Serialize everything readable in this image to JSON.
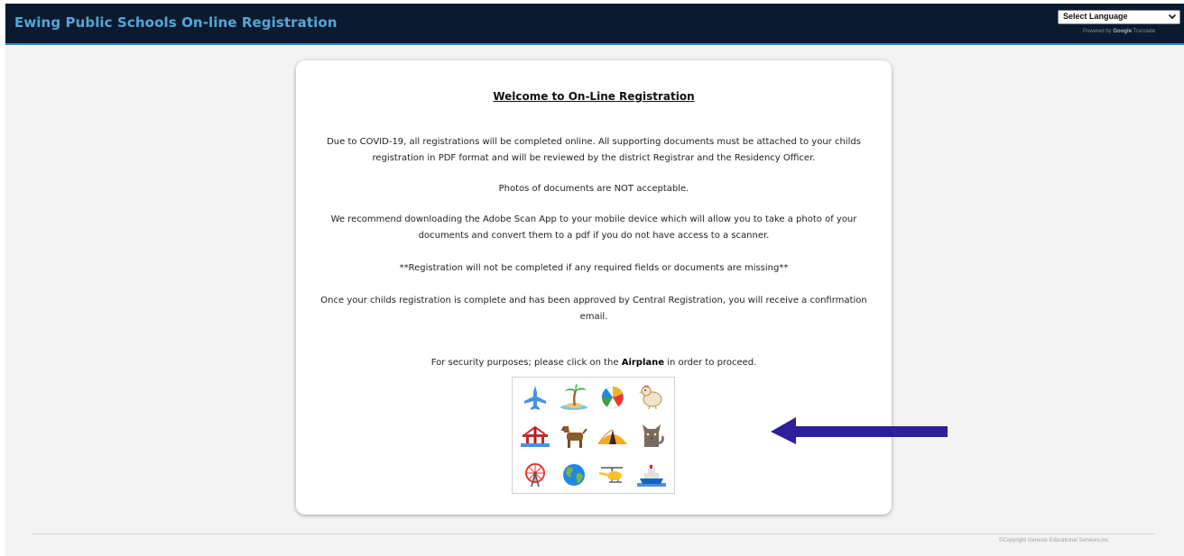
{
  "header": {
    "title": "Ewing Public Schools On-line Registration",
    "language_select": {
      "selected": "Select Language",
      "powered_prefix": "Powered by ",
      "powered_brand": "Google",
      "powered_suffix": " Translate"
    }
  },
  "card": {
    "title": "Welcome to On-Line Registration",
    "paragraphs": [
      "Due to COVID-19, all registrations will be completed online. All supporting documents must be attached to your childs registration in PDF format and will be reviewed by the district Registrar and the Residency Officer.",
      "Photos of documents are NOT acceptable.",
      "We recommend downloading the Adobe Scan App to your mobile device which will allow you to take a photo of your documents and convert them to a pdf if you do not have access to a scanner.",
      "**Registration will not be completed if any required fields or documents are missing**",
      "Once your childs registration is complete and has been approved by Central Registration, you will receive a confirmation email."
    ],
    "security": {
      "prefix": "For security purposes; please click on the ",
      "target": "Airplane",
      "suffix": " in order to proceed."
    },
    "captcha_icons": [
      "airplane-icon",
      "palm-tree-island-icon",
      "beach-ball-icon",
      "chicken-icon",
      "bridge-icon",
      "dog-icon",
      "tent-icon",
      "cat-icon",
      "ferris-wheel-icon",
      "globe-icon",
      "helicopter-icon",
      "ship-icon"
    ]
  },
  "footer": {
    "copyright": "©Copyright Genesis Educational Services,Inc."
  },
  "colors": {
    "header_bg": "#0b1a30",
    "header_title": "#52a8d8",
    "page_bg": "#f3f3f3",
    "arrow": "#2e1f9c"
  }
}
